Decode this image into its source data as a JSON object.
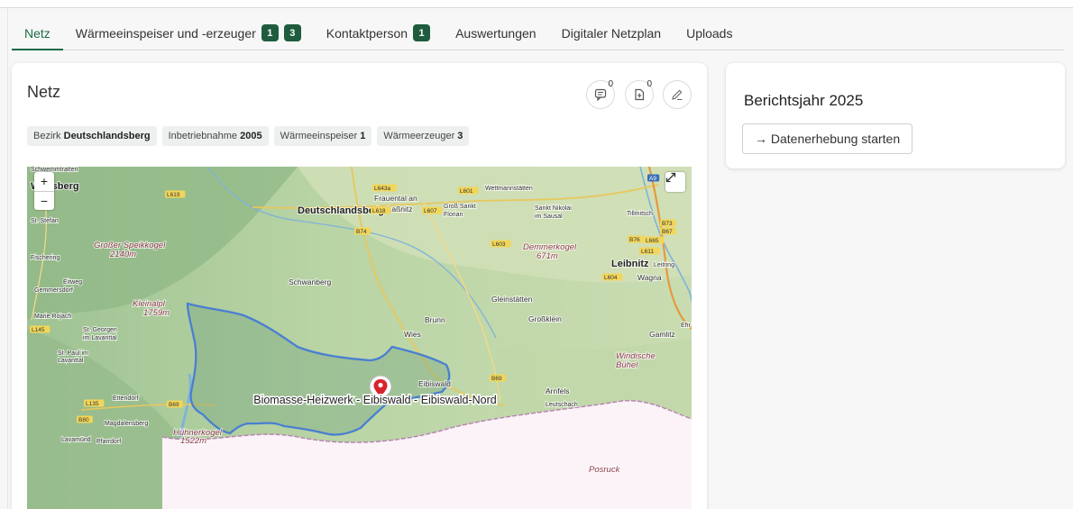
{
  "tabs": [
    {
      "label": "Netz",
      "active": true
    },
    {
      "label": "Wärmeeinspeiser und -erzeuger",
      "badges": [
        "1",
        "3"
      ]
    },
    {
      "label": "Kontaktperson",
      "badges": [
        "1"
      ]
    },
    {
      "label": "Auswertungen"
    },
    {
      "label": "Digitaler Netzplan"
    },
    {
      "label": "Uploads"
    }
  ],
  "netz": {
    "title": "Netz",
    "comments_count": "0",
    "attachments_count": "0",
    "chips": [
      {
        "key": "Bezirk",
        "value": "Deutschlandsberg"
      },
      {
        "key": "Inbetriebnahme",
        "value": "2005"
      },
      {
        "key": "Wärmeeinspeiser",
        "value": "1"
      },
      {
        "key": "Wärmeerzeuger",
        "value": "3"
      }
    ]
  },
  "map": {
    "zoom_in": "+",
    "zoom_out": "−",
    "marker_label": "Biomasse-Heizwerk - Eibiswald - Eibiswald-Nord",
    "places": [
      {
        "name": "Deutschlandsberg",
        "cls": "town"
      },
      {
        "name": "Frauental an",
        "cls": "small"
      },
      {
        "name": "der Laßnitz",
        "cls": "small"
      },
      {
        "name": "Wettmannstätten",
        "cls": "tiny"
      },
      {
        "name": "Groß Sankt",
        "cls": "tiny"
      },
      {
        "name": "Florian",
        "cls": "tiny"
      },
      {
        "name": "Sankt Nikolai",
        "cls": "tiny"
      },
      {
        "name": "im Sausal",
        "cls": "tiny"
      },
      {
        "name": "Tillmitsch",
        "cls": "tiny"
      },
      {
        "name": "Großer Speikkogel",
        "cls": "peak"
      },
      {
        "name": "2140m",
        "cls": "peak"
      },
      {
        "name": "Demmerkogel",
        "cls": "peak"
      },
      {
        "name": "671m",
        "cls": "peak"
      },
      {
        "name": "Leibnitz",
        "cls": "town"
      },
      {
        "name": "Leitring",
        "cls": "tiny"
      },
      {
        "name": "Wagna",
        "cls": "small"
      },
      {
        "name": "Schwanberg",
        "cls": "small"
      },
      {
        "name": "Kleinalpl",
        "cls": "peak"
      },
      {
        "name": "1759m",
        "cls": "peak"
      },
      {
        "name": "Gleinstätten",
        "cls": "small"
      },
      {
        "name": "Großklein",
        "cls": "small"
      },
      {
        "name": "Brunn",
        "cls": "small"
      },
      {
        "name": "Wies",
        "cls": "small"
      },
      {
        "name": "Gamlitz",
        "cls": "small"
      },
      {
        "name": "Windische",
        "cls": "peak"
      },
      {
        "name": "Bühel",
        "cls": "peak"
      },
      {
        "name": "Arnfels",
        "cls": "small"
      },
      {
        "name": "Leutschach",
        "cls": "tiny"
      },
      {
        "name": "Eibiswald",
        "cls": "small"
      },
      {
        "name": "Marie Rojach",
        "cls": "tiny"
      },
      {
        "name": "St. Georgen",
        "cls": "tiny"
      },
      {
        "name": "im Lavanttal",
        "cls": "tiny"
      },
      {
        "name": "St. Paul im",
        "cls": "tiny"
      },
      {
        "name": "Lavanttal",
        "cls": "tiny"
      },
      {
        "name": "Ettendorf",
        "cls": "tiny"
      },
      {
        "name": "Magdalensberg",
        "cls": "tiny"
      },
      {
        "name": "Lavamünd",
        "cls": "tiny"
      },
      {
        "name": "Pfarrdorf",
        "cls": "tiny"
      },
      {
        "name": "Hühnerkogel",
        "cls": "peak"
      },
      {
        "name": "1522m",
        "cls": "peak"
      },
      {
        "name": "Eitweg",
        "cls": "tiny"
      },
      {
        "name": "Gemmersdorf",
        "cls": "tiny"
      },
      {
        "name": "Fischering",
        "cls": "tiny"
      },
      {
        "name": "Posruck",
        "cls": "peak"
      },
      {
        "name": "Ehr",
        "cls": "tiny"
      },
      {
        "name": "Schwemmtratten",
        "cls": "tiny"
      },
      {
        "name": "St. Stefan",
        "cls": "tiny"
      },
      {
        "name": "Wolfsberg",
        "cls": "town"
      }
    ],
    "roads": [
      "L619",
      "L643a",
      "L601",
      "L618",
      "L607",
      "B74",
      "L603",
      "B76",
      "L604",
      "L665",
      "B73",
      "B67",
      "L611",
      "L145",
      "L135",
      "B80",
      "B69",
      "B69",
      "A9"
    ]
  },
  "report": {
    "title": "Berichtsjahr 2025",
    "button_label": "→ Datenerhebung starten"
  }
}
